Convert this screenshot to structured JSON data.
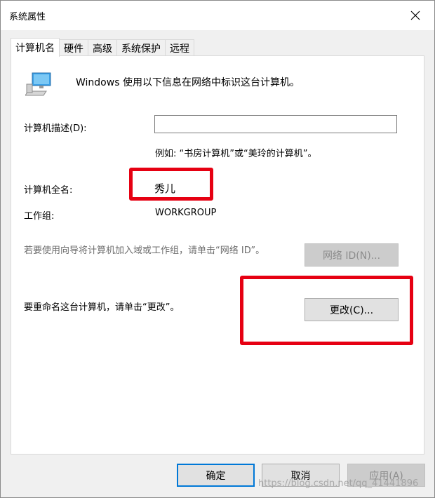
{
  "window": {
    "title": "系统属性",
    "close_icon": "close-icon"
  },
  "tabs": [
    {
      "label": "计算机名",
      "active": true
    },
    {
      "label": "硬件",
      "active": false
    },
    {
      "label": "高级",
      "active": false
    },
    {
      "label": "系统保护",
      "active": false
    },
    {
      "label": "远程",
      "active": false
    }
  ],
  "panel": {
    "intro_text": "Windows 使用以下信息在网络中标识这台计算机。",
    "description_label": "计算机描述(D):",
    "description_value": "",
    "description_example": "例如: “书房计算机”或“美玲的计算机”。",
    "fullname_label": "计算机全名:",
    "fullname_value": "秀儿",
    "workgroup_label": "工作组:",
    "workgroup_value": "WORKGROUP",
    "network_id_text": "若要使用向导将计算机加入域或工作组，请单击“网络 ID”。",
    "network_id_button": "网络 ID(N)...",
    "rename_text": "要重命名这台计算机，请单击“更改”。",
    "change_button": "更改(C)..."
  },
  "footer": {
    "ok_button": "确定",
    "cancel_button": "取消",
    "apply_button": "应用(A)"
  },
  "watermark": "https://blog.csdn.net/qq_41441896",
  "colors": {
    "highlight": "#e60012",
    "focus_border": "#0078d7",
    "input_border": "#7a7a7a"
  }
}
